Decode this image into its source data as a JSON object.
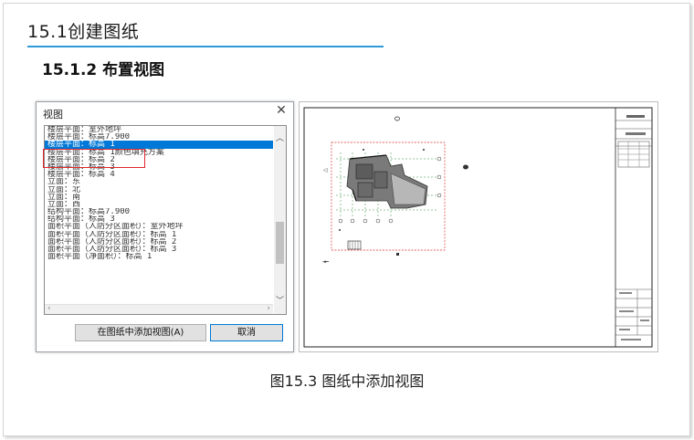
{
  "heading": {
    "section": "15.1创建图纸",
    "subsection": "15.1.2 布置视图"
  },
  "dialog": {
    "title": "视图",
    "close_icon": "close-icon",
    "items": [
      "楼层平面：室外地坪",
      "楼层平面：标高7.900",
      "楼层平面：标高 1",
      "楼层平面：标高 1颜色填充方案",
      "楼层平面：标高 2",
      "楼层平面：标高 3",
      "楼层平面：标高 4",
      "立面：东",
      "立面：北",
      "立面：南",
      "立面：西",
      "结构平面：标高7.900",
      "结构平面：标高 3",
      "面积平面（人防分区面积）：室外地坪",
      "面积平面（人防分区面积）：标高 1",
      "面积平面（人防分区面积）：标高 2",
      "面积平面（人防分区面积）：标高 3",
      "面积平面（净面积）：标高 1"
    ],
    "selected_index": 2,
    "add_button": "在图纸中添加视图(A)",
    "cancel_button": "取消"
  },
  "caption": "图15.3  图纸中添加视图",
  "colors": {
    "accent_rule": "#2f9ad6",
    "selection": "#0078d7",
    "highlight": "#e0262b",
    "plan_fill": "#7a7a7a",
    "grid_green": "#2a8a3a"
  }
}
